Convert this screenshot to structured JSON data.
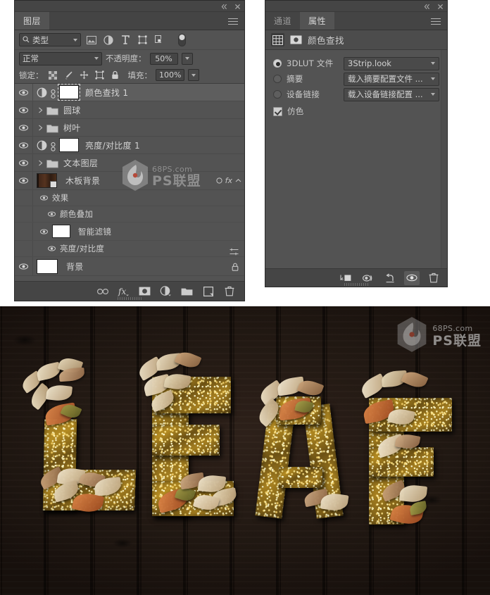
{
  "app": {
    "theme_bg": "#535353",
    "accent_text": "#d3d3d3"
  },
  "layers_panel": {
    "titlebar": {
      "collapse_icon": "double-chevron-left-icon",
      "close_icon": "close-icon"
    },
    "tabs": [
      {
        "label": "图层",
        "active": true
      }
    ],
    "menu_icon": "panel-menu-icon",
    "filter": {
      "search_icon": "search-icon",
      "kind_label": "类型",
      "icons": [
        "filter-pixel-icon",
        "filter-adjustment-icon",
        "filter-type-icon",
        "filter-shape-icon",
        "filter-smartobject-icon"
      ],
      "toggle_icon": "filter-toggle-switch"
    },
    "blend": {
      "mode": "正常",
      "opacity_label": "不透明度：",
      "opacity_value": "50%"
    },
    "lock": {
      "label": "锁定：",
      "icons": [
        "lock-transparent-pixels-icon",
        "lock-image-pixels-icon",
        "lock-position-icon",
        "lock-artboard-nesting-icon",
        "lock-all-icon"
      ],
      "fill_label": "填充：",
      "fill_value": "100%"
    },
    "layers": [
      {
        "name": "颜色查找 1",
        "type": "adjustment",
        "visible": true,
        "selected": true,
        "has_mask": true,
        "linked": true,
        "indent": 0
      },
      {
        "name": "圆球",
        "type": "group",
        "visible": true,
        "selected": false,
        "expanded": false,
        "indent": 0
      },
      {
        "name": "树叶",
        "type": "group",
        "visible": true,
        "selected": false,
        "expanded": false,
        "indent": 0
      },
      {
        "name": "亮度/对比度 1",
        "type": "adjustment",
        "visible": true,
        "selected": false,
        "has_mask": true,
        "linked": true,
        "indent": 0
      },
      {
        "name": "文本图层",
        "type": "group",
        "visible": true,
        "selected": false,
        "expanded": false,
        "indent": 0
      },
      {
        "name": "木板背景",
        "type": "smart-object",
        "visible": true,
        "selected": false,
        "fx_label": "fx",
        "indent": 0
      },
      {
        "name": "效果",
        "type": "effects-header",
        "visible": true,
        "indent": 1
      },
      {
        "name": "颜色叠加",
        "type": "effect",
        "visible": true,
        "indent": 2
      },
      {
        "name": "智能滤镜",
        "type": "smart-filter-header",
        "visible": true,
        "indent": 1,
        "has_mask": true
      },
      {
        "name": "亮度/对比度",
        "type": "smart-filter",
        "visible": true,
        "indent": 2,
        "has_settings": true
      },
      {
        "name": "背景",
        "type": "locked-background",
        "visible": true,
        "indent": 0,
        "locked": true
      }
    ],
    "footer_icons": [
      "link-layers-icon",
      "add-layer-style-fx-icon",
      "add-layer-mask-icon",
      "new-adjustment-layer-icon",
      "new-group-icon",
      "new-layer-icon",
      "delete-layer-icon"
    ],
    "watermark": {
      "domain": "68PS.com",
      "brand": "PS联盟"
    }
  },
  "properties_panel": {
    "titlebar": {
      "collapse_icon": "double-chevron-left-icon",
      "close_icon": "close-icon"
    },
    "tabs": [
      {
        "label": "通道",
        "active": false
      },
      {
        "label": "属性",
        "active": true
      }
    ],
    "menu_icon": "panel-menu-icon",
    "header": {
      "grid_icon": "properties-grid-icon",
      "mask_icon": "properties-mask-icon",
      "title": "颜色查找"
    },
    "options": [
      {
        "label": "3DLUT 文件",
        "selected": true,
        "value": "3Strip.look"
      },
      {
        "label": "摘要",
        "selected": false,
        "value": "载入摘要配置文件 ..."
      },
      {
        "label": "设备链接",
        "selected": false,
        "value": "载入设备链接配置 ..."
      }
    ],
    "dither": {
      "label": "仿色",
      "checked": true
    },
    "footer_icons": [
      "clip-to-layer-icon",
      "view-previous-state-icon",
      "reset-icon",
      "toggle-visibility-icon",
      "delete-icon"
    ]
  },
  "artwork": {
    "text": "LEAF",
    "style": "glitter-gold-3d-letters-with-autumn-leaves",
    "background": "dark-wood-planks",
    "watermark": {
      "domain": "68PS.com",
      "brand": "PS联盟"
    },
    "colors": {
      "glitter_gold": "#b58c22",
      "wood_dark": "#211711",
      "leaf_cream": "#e3d3b4",
      "leaf_orange": "#c86a33"
    }
  }
}
